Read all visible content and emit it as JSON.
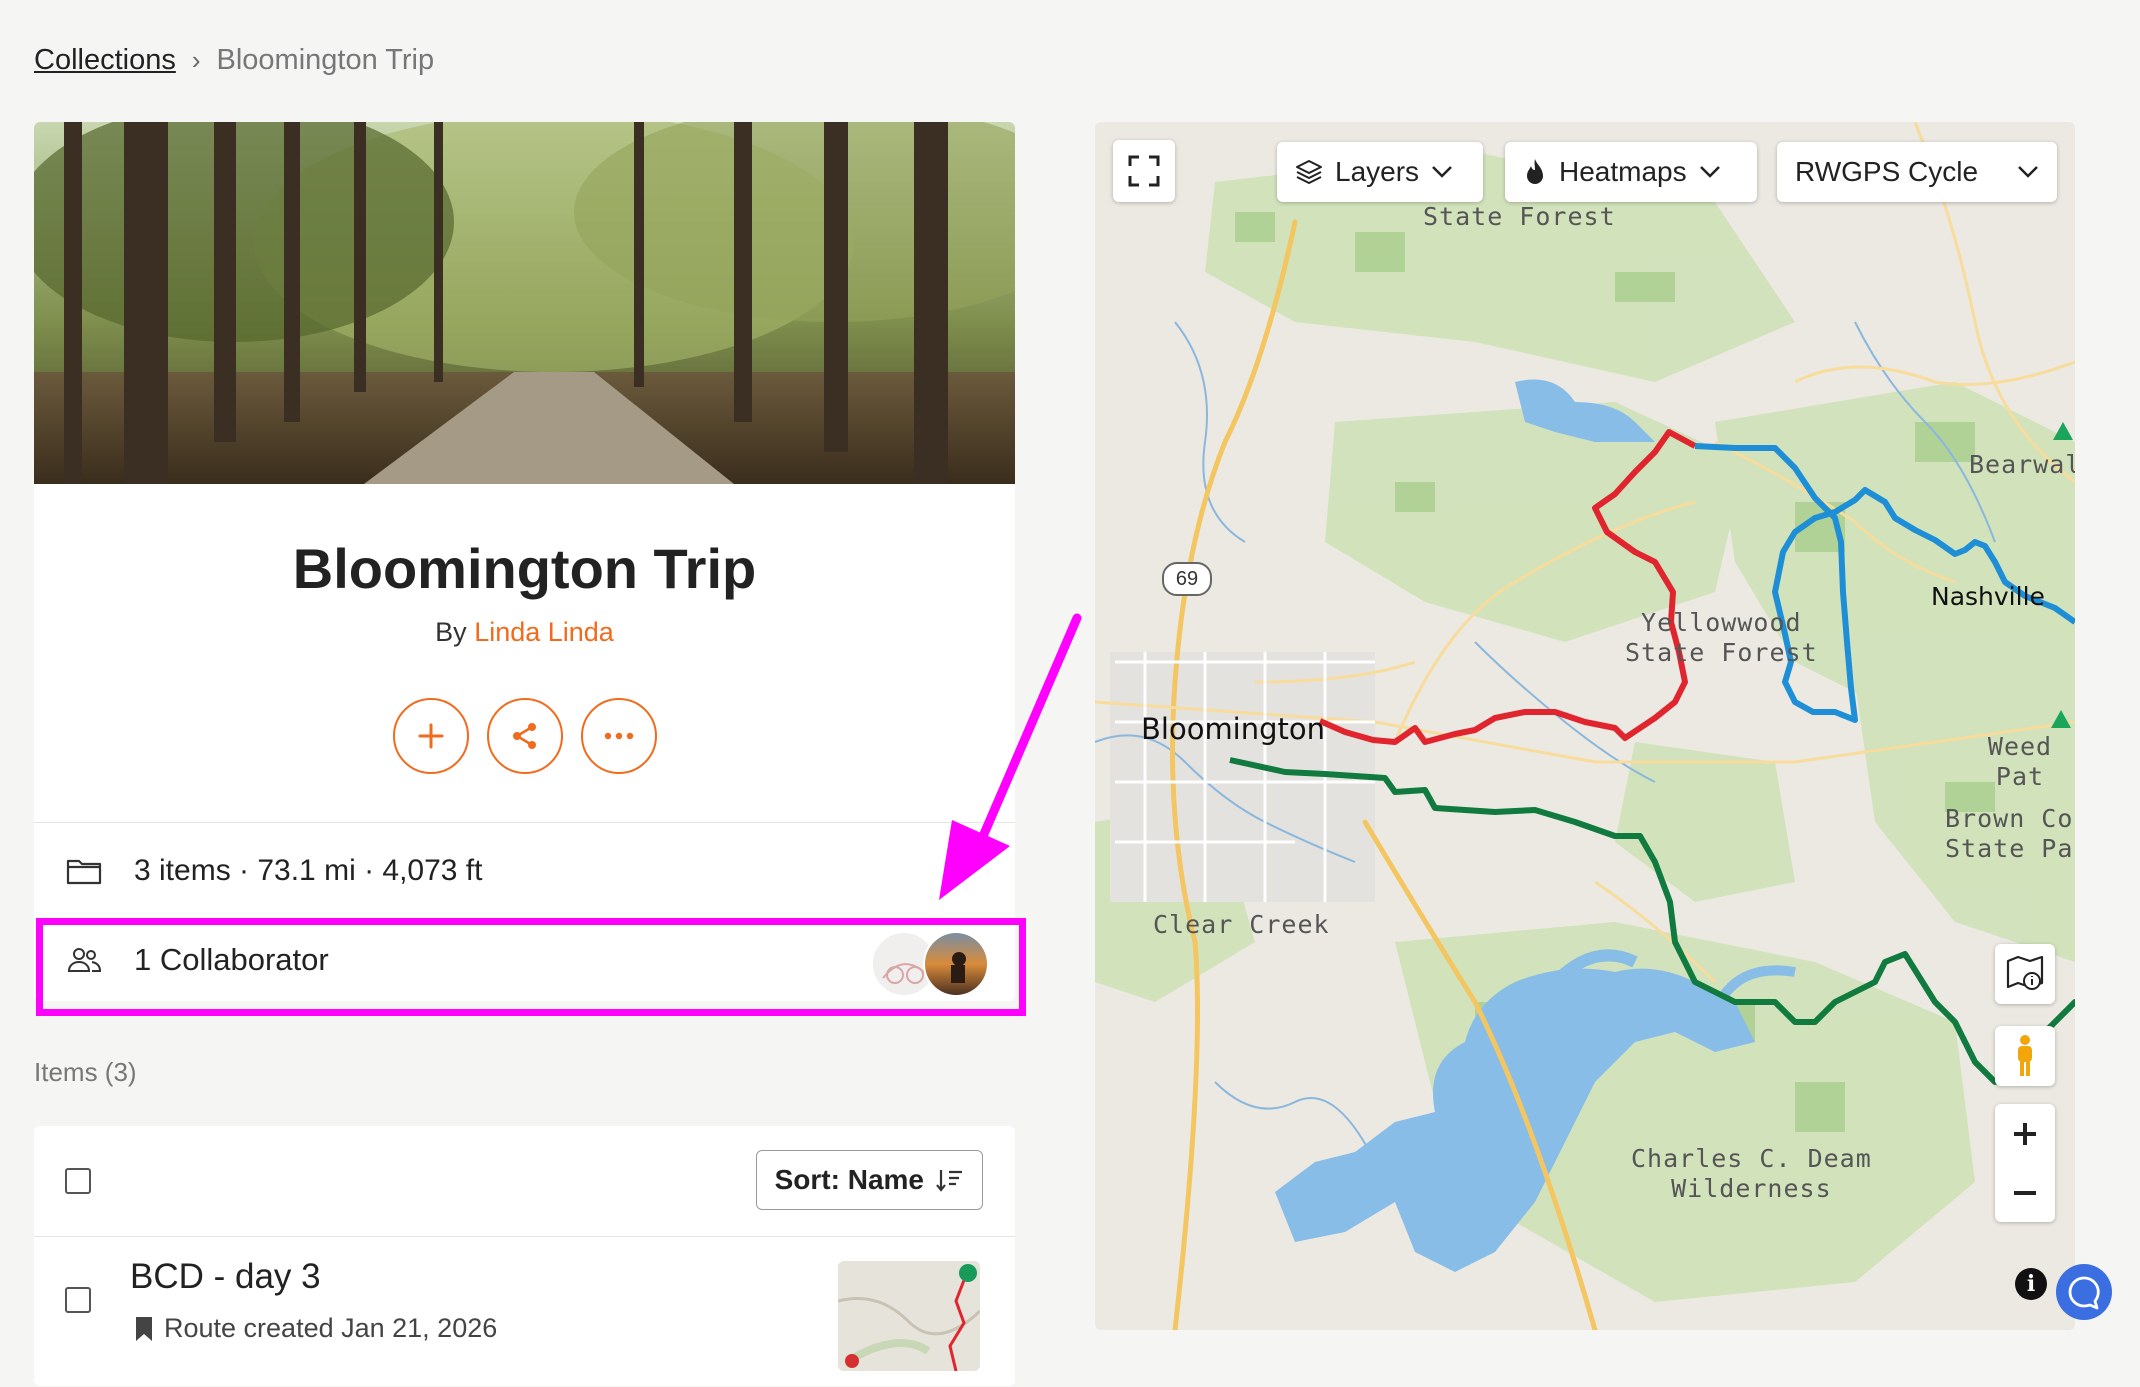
{
  "breadcrumb": {
    "link": "Collections",
    "separator": "›",
    "current": "Bloomington Trip"
  },
  "collection": {
    "title": "Bloomington Trip",
    "by_prefix": "By",
    "author": "Linda Linda",
    "actions": [
      "add-icon",
      "share-icon",
      "more-icon"
    ],
    "stats": "3 items · 73.1 mi · 4,073 ft",
    "collaborators": "1 Collaborator"
  },
  "items": {
    "heading": "Items (3)",
    "sort_label": "Sort: Name",
    "list": [
      {
        "title": "BCD - day 3",
        "meta": "Route created Jan 21, 2026"
      }
    ]
  },
  "map": {
    "controls": {
      "layers": "Layers",
      "heatmaps": "Heatmaps",
      "style": "RWGPS Cycle"
    },
    "labels": {
      "state_forest_top": "State Forest",
      "bearwall": "Bearwall",
      "yellowwood": "Yellowwood\nState Forest",
      "nashville": "Nashville",
      "weed_patch": "Weed Pat",
      "brown_county": "Brown Co\nState Pa",
      "bloomington": "Bloomington",
      "clear_creek": "Clear Creek",
      "deam": "Charles C. Deam\nWilderness",
      "highway": "69"
    },
    "route_colors": {
      "red": "#e0252e",
      "blue": "#1e8fd6",
      "green": "#117a3e"
    }
  },
  "colors": {
    "accent": "#f26a1b",
    "highlight": "#ff00ff"
  }
}
